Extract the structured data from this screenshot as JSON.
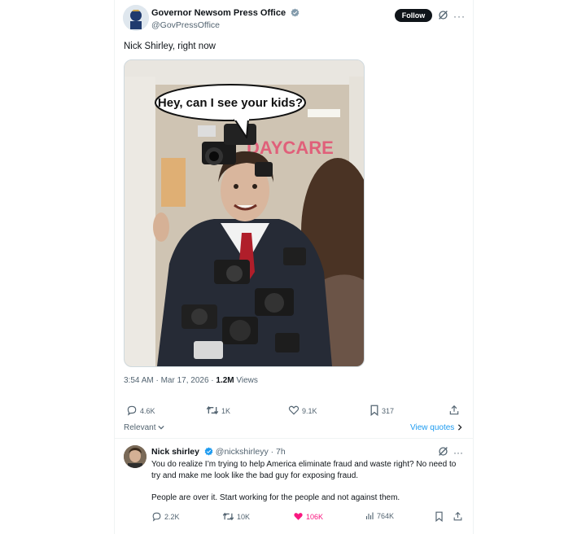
{
  "tweet": {
    "author_name": "Governor Newsom Press Office",
    "author_handle": "@GovPressOffice",
    "follow_label": "Follow",
    "text": "Nick Shirley, right now",
    "image": {
      "speech_bubble": "Hey, can I see your kids?",
      "sign": "DAYCARE"
    },
    "timestamp": "3:54 AM · Mar 17, 2026 · ",
    "views_count": "1.2M",
    "views_label": " Views",
    "stats": {
      "replies": "4.6K",
      "reposts": "1K",
      "likes": "9.1K",
      "bookmarks": "317"
    },
    "sort_label": "Relevant",
    "view_quotes": "View quotes"
  },
  "reply": {
    "author_name": "Nick shirley",
    "author_handle": "@nickshirleyy · 7h",
    "paragraph1": "You do realize I’m trying to help America eliminate fraud and waste right? No need to try and make me look like the bad guy for exposing fraud.",
    "paragraph2": "People are over it. Start working for the people and not against them.",
    "stats": {
      "replies": "2.2K",
      "reposts": "10K",
      "likes": "106K",
      "views": "764K"
    }
  },
  "colors": {
    "verified": "#1d9bf0",
    "liked": "#f91880",
    "link": "#1d9bf0"
  }
}
